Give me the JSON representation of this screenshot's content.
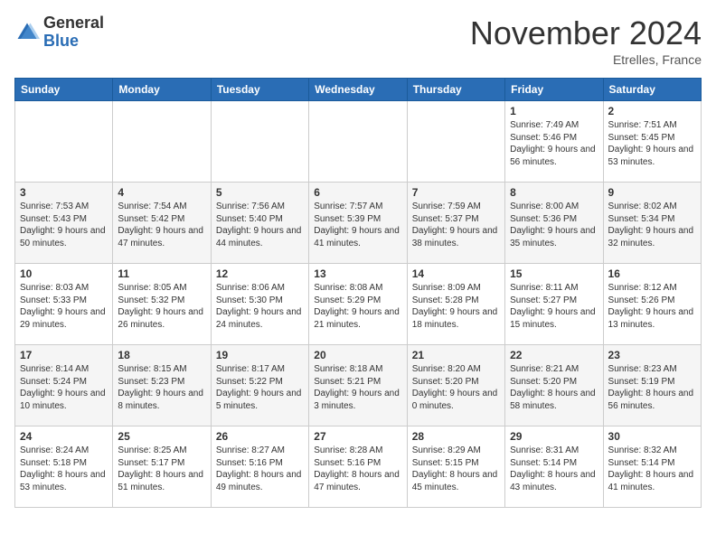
{
  "logo": {
    "general": "General",
    "blue": "Blue"
  },
  "header": {
    "month": "November 2024",
    "location": "Etrelles, France"
  },
  "weekdays": [
    "Sunday",
    "Monday",
    "Tuesday",
    "Wednesday",
    "Thursday",
    "Friday",
    "Saturday"
  ],
  "weeks": [
    [
      {
        "day": "",
        "sunrise": "",
        "sunset": "",
        "daylight": ""
      },
      {
        "day": "",
        "sunrise": "",
        "sunset": "",
        "daylight": ""
      },
      {
        "day": "",
        "sunrise": "",
        "sunset": "",
        "daylight": ""
      },
      {
        "day": "",
        "sunrise": "",
        "sunset": "",
        "daylight": ""
      },
      {
        "day": "",
        "sunrise": "",
        "sunset": "",
        "daylight": ""
      },
      {
        "day": "1",
        "sunrise": "Sunrise: 7:49 AM",
        "sunset": "Sunset: 5:46 PM",
        "daylight": "Daylight: 9 hours and 56 minutes."
      },
      {
        "day": "2",
        "sunrise": "Sunrise: 7:51 AM",
        "sunset": "Sunset: 5:45 PM",
        "daylight": "Daylight: 9 hours and 53 minutes."
      }
    ],
    [
      {
        "day": "3",
        "sunrise": "Sunrise: 7:53 AM",
        "sunset": "Sunset: 5:43 PM",
        "daylight": "Daylight: 9 hours and 50 minutes."
      },
      {
        "day": "4",
        "sunrise": "Sunrise: 7:54 AM",
        "sunset": "Sunset: 5:42 PM",
        "daylight": "Daylight: 9 hours and 47 minutes."
      },
      {
        "day": "5",
        "sunrise": "Sunrise: 7:56 AM",
        "sunset": "Sunset: 5:40 PM",
        "daylight": "Daylight: 9 hours and 44 minutes."
      },
      {
        "day": "6",
        "sunrise": "Sunrise: 7:57 AM",
        "sunset": "Sunset: 5:39 PM",
        "daylight": "Daylight: 9 hours and 41 minutes."
      },
      {
        "day": "7",
        "sunrise": "Sunrise: 7:59 AM",
        "sunset": "Sunset: 5:37 PM",
        "daylight": "Daylight: 9 hours and 38 minutes."
      },
      {
        "day": "8",
        "sunrise": "Sunrise: 8:00 AM",
        "sunset": "Sunset: 5:36 PM",
        "daylight": "Daylight: 9 hours and 35 minutes."
      },
      {
        "day": "9",
        "sunrise": "Sunrise: 8:02 AM",
        "sunset": "Sunset: 5:34 PM",
        "daylight": "Daylight: 9 hours and 32 minutes."
      }
    ],
    [
      {
        "day": "10",
        "sunrise": "Sunrise: 8:03 AM",
        "sunset": "Sunset: 5:33 PM",
        "daylight": "Daylight: 9 hours and 29 minutes."
      },
      {
        "day": "11",
        "sunrise": "Sunrise: 8:05 AM",
        "sunset": "Sunset: 5:32 PM",
        "daylight": "Daylight: 9 hours and 26 minutes."
      },
      {
        "day": "12",
        "sunrise": "Sunrise: 8:06 AM",
        "sunset": "Sunset: 5:30 PM",
        "daylight": "Daylight: 9 hours and 24 minutes."
      },
      {
        "day": "13",
        "sunrise": "Sunrise: 8:08 AM",
        "sunset": "Sunset: 5:29 PM",
        "daylight": "Daylight: 9 hours and 21 minutes."
      },
      {
        "day": "14",
        "sunrise": "Sunrise: 8:09 AM",
        "sunset": "Sunset: 5:28 PM",
        "daylight": "Daylight: 9 hours and 18 minutes."
      },
      {
        "day": "15",
        "sunrise": "Sunrise: 8:11 AM",
        "sunset": "Sunset: 5:27 PM",
        "daylight": "Daylight: 9 hours and 15 minutes."
      },
      {
        "day": "16",
        "sunrise": "Sunrise: 8:12 AM",
        "sunset": "Sunset: 5:26 PM",
        "daylight": "Daylight: 9 hours and 13 minutes."
      }
    ],
    [
      {
        "day": "17",
        "sunrise": "Sunrise: 8:14 AM",
        "sunset": "Sunset: 5:24 PM",
        "daylight": "Daylight: 9 hours and 10 minutes."
      },
      {
        "day": "18",
        "sunrise": "Sunrise: 8:15 AM",
        "sunset": "Sunset: 5:23 PM",
        "daylight": "Daylight: 9 hours and 8 minutes."
      },
      {
        "day": "19",
        "sunrise": "Sunrise: 8:17 AM",
        "sunset": "Sunset: 5:22 PM",
        "daylight": "Daylight: 9 hours and 5 minutes."
      },
      {
        "day": "20",
        "sunrise": "Sunrise: 8:18 AM",
        "sunset": "Sunset: 5:21 PM",
        "daylight": "Daylight: 9 hours and 3 minutes."
      },
      {
        "day": "21",
        "sunrise": "Sunrise: 8:20 AM",
        "sunset": "Sunset: 5:20 PM",
        "daylight": "Daylight: 9 hours and 0 minutes."
      },
      {
        "day": "22",
        "sunrise": "Sunrise: 8:21 AM",
        "sunset": "Sunset: 5:20 PM",
        "daylight": "Daylight: 8 hours and 58 minutes."
      },
      {
        "day": "23",
        "sunrise": "Sunrise: 8:23 AM",
        "sunset": "Sunset: 5:19 PM",
        "daylight": "Daylight: 8 hours and 56 minutes."
      }
    ],
    [
      {
        "day": "24",
        "sunrise": "Sunrise: 8:24 AM",
        "sunset": "Sunset: 5:18 PM",
        "daylight": "Daylight: 8 hours and 53 minutes."
      },
      {
        "day": "25",
        "sunrise": "Sunrise: 8:25 AM",
        "sunset": "Sunset: 5:17 PM",
        "daylight": "Daylight: 8 hours and 51 minutes."
      },
      {
        "day": "26",
        "sunrise": "Sunrise: 8:27 AM",
        "sunset": "Sunset: 5:16 PM",
        "daylight": "Daylight: 8 hours and 49 minutes."
      },
      {
        "day": "27",
        "sunrise": "Sunrise: 8:28 AM",
        "sunset": "Sunset: 5:16 PM",
        "daylight": "Daylight: 8 hours and 47 minutes."
      },
      {
        "day": "28",
        "sunrise": "Sunrise: 8:29 AM",
        "sunset": "Sunset: 5:15 PM",
        "daylight": "Daylight: 8 hours and 45 minutes."
      },
      {
        "day": "29",
        "sunrise": "Sunrise: 8:31 AM",
        "sunset": "Sunset: 5:14 PM",
        "daylight": "Daylight: 8 hours and 43 minutes."
      },
      {
        "day": "30",
        "sunrise": "Sunrise: 8:32 AM",
        "sunset": "Sunset: 5:14 PM",
        "daylight": "Daylight: 8 hours and 41 minutes."
      }
    ]
  ]
}
